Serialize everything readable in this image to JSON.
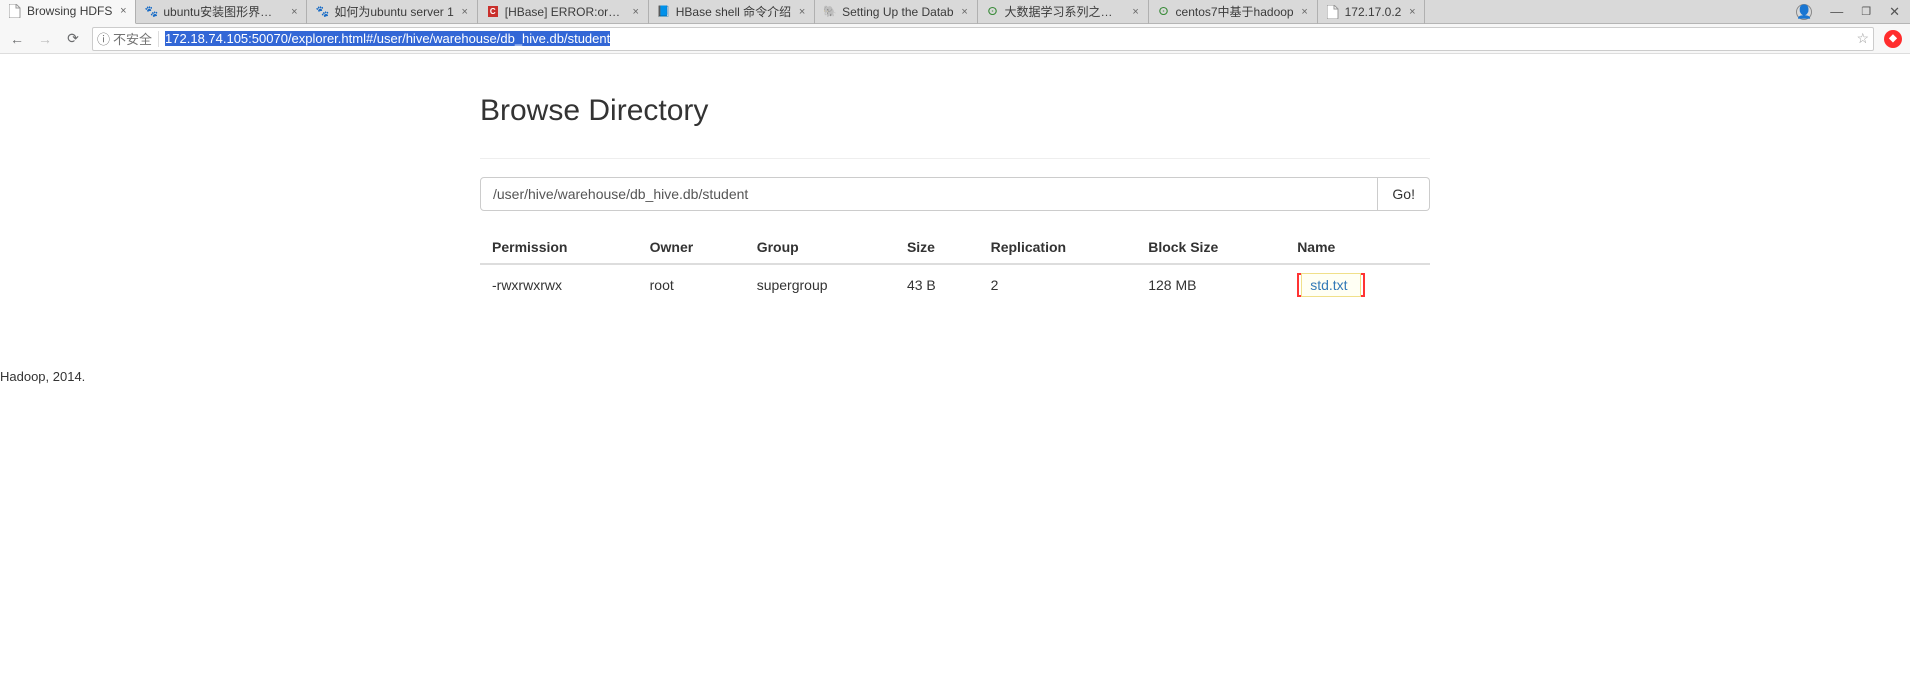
{
  "browser": {
    "tabs": [
      {
        "title": "Browsing HDFS",
        "active": true,
        "icon": "page"
      },
      {
        "title": "ubuntu安装图形界面_百",
        "active": false,
        "icon": "baidu"
      },
      {
        "title": "如何为ubuntu server 1",
        "active": false,
        "icon": "baidu"
      },
      {
        "title": "[HBase] ERROR:org.ap",
        "active": false,
        "icon": "csdn"
      },
      {
        "title": "HBase shell 命令介绍",
        "active": false,
        "icon": "cnblogs"
      },
      {
        "title": "Setting Up the Datab",
        "active": false,
        "icon": "hadoop"
      },
      {
        "title": "大数据学习系列之八----",
        "active": false,
        "icon": "oschina"
      },
      {
        "title": "centos7中基于hadoop",
        "active": false,
        "icon": "oschina"
      },
      {
        "title": "172.17.0.2",
        "active": false,
        "icon": "page"
      }
    ],
    "nav": {
      "insecure_label": "不安全",
      "url": "172.18.74.105:50070/explorer.html#/user/hive/warehouse/db_hive.db/student"
    }
  },
  "page": {
    "heading": "Browse Directory",
    "path_value": "/user/hive/warehouse/db_hive.db/student",
    "go_label": "Go!",
    "columns": [
      "Permission",
      "Owner",
      "Group",
      "Size",
      "Replication",
      "Block Size",
      "Name"
    ],
    "rows": [
      {
        "permission": "-rwxrwxrwx",
        "owner": "root",
        "group": "supergroup",
        "size": "43 B",
        "replication": "2",
        "block_size": "128 MB",
        "name": "std.txt"
      }
    ],
    "footer": "Hadoop, 2014."
  }
}
